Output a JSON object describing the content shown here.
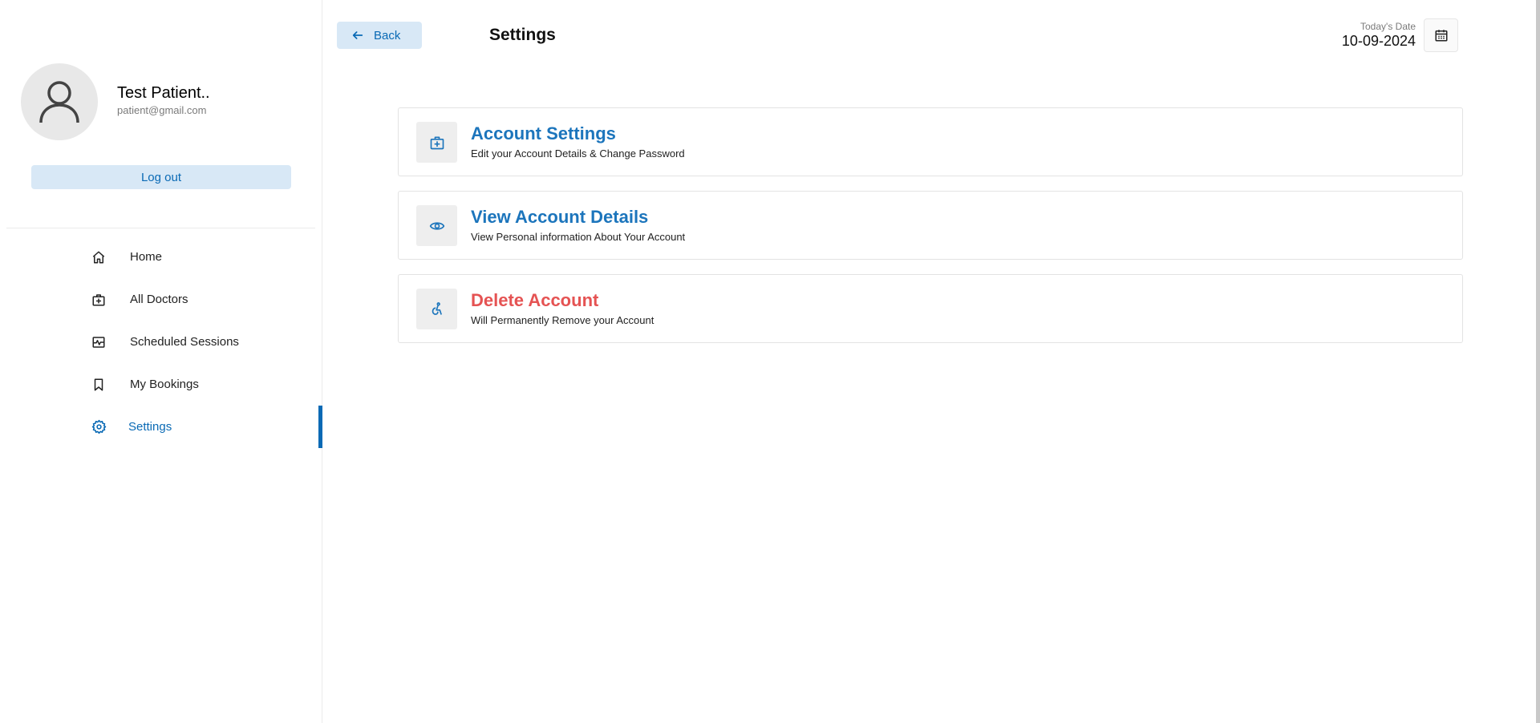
{
  "profile": {
    "name": "Test Patient..",
    "email": "patient@gmail.com",
    "logout_label": "Log out"
  },
  "sidebar": {
    "items": [
      {
        "label": "Home",
        "icon": "home-icon",
        "active": false
      },
      {
        "label": "All Doctors",
        "icon": "medical-bag-icon",
        "active": false
      },
      {
        "label": "Scheduled Sessions",
        "icon": "activity-icon",
        "active": false
      },
      {
        "label": "My Bookings",
        "icon": "bookmark-icon",
        "active": false
      },
      {
        "label": "Settings",
        "icon": "gear-icon",
        "active": true
      }
    ]
  },
  "header": {
    "back_label": "Back",
    "title": "Settings",
    "date_label": "Today's Date",
    "date_value": "10-09-2024"
  },
  "cards": [
    {
      "title": "Account Settings",
      "subtitle": "Edit your Account Details & Change Password",
      "icon": "medical-bag-icon",
      "tone": "primary"
    },
    {
      "title": "View Account Details",
      "subtitle": "View Personal information About Your Account",
      "icon": "eye-icon",
      "tone": "primary"
    },
    {
      "title": "Delete Account",
      "subtitle": "Will Permanently Remove your Account",
      "icon": "accessibility-icon",
      "tone": "danger"
    }
  ],
  "colors": {
    "accent": "#0a6ab5",
    "accent_light": "#d8e8f6",
    "card_title": "#1c75bc",
    "danger": "#e55353"
  }
}
